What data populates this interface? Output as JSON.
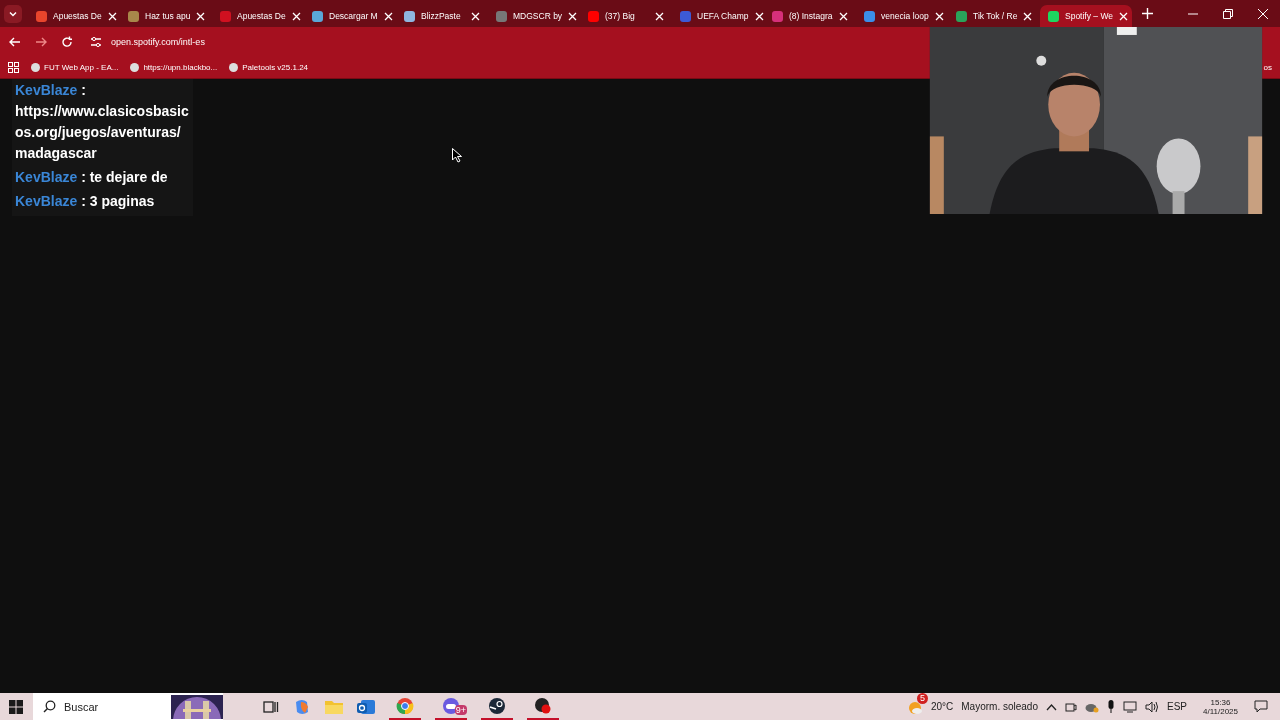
{
  "tabs": [
    {
      "title": "Apuestas De",
      "selected": false,
      "color": "#e8452c"
    },
    {
      "title": "Haz tus apu",
      "selected": false,
      "color": "#a8874a"
    },
    {
      "title": "Apuestas De",
      "selected": false,
      "color": "#d01020"
    },
    {
      "title": "Descargar M",
      "selected": false,
      "color": "#5aa7d8"
    },
    {
      "title": "BlizzPaste",
      "selected": false,
      "color": "#8fb6e0"
    },
    {
      "title": "MDGSCR by",
      "selected": false,
      "color": "#777777"
    },
    {
      "title": "(37) Big",
      "selected": false,
      "color": "#ff0000"
    },
    {
      "title": "UEFA Champ",
      "selected": false,
      "color": "#3d5ad6"
    },
    {
      "title": "(8) Instagra",
      "selected": false,
      "color": "#d6307a"
    },
    {
      "title": "venecia loop",
      "selected": false,
      "color": "#3b8ee8"
    },
    {
      "title": "Tik Tok / Re",
      "selected": false,
      "color": "#2aa35a"
    },
    {
      "title": "Spotify – We",
      "selected": true,
      "color": "#1ed760"
    }
  ],
  "address": "open.spotify.com/intl-es",
  "bookmarks": [
    "FUT Web App - EA...",
    "https://upn.blackbo...",
    "Paletools v25.1.24"
  ],
  "bookmarks_end": "os",
  "chat": [
    {
      "user": "KevBlaze",
      "text": ": https://www.clasicosbasicos.org/juegos/aventuras/madagascar"
    },
    {
      "user": "KevBlaze",
      "text": ": te dejare de"
    },
    {
      "user": "KevBlaze",
      "text": ": 3 paginas"
    }
  ],
  "taskbar": {
    "search_placeholder": "Buscar",
    "badge": "9+",
    "weather_alert": "5",
    "temperature": "20°C",
    "weather": "Mayorm. soleado",
    "language": "ESP",
    "time": "15:36",
    "date": "4/11/2025"
  }
}
